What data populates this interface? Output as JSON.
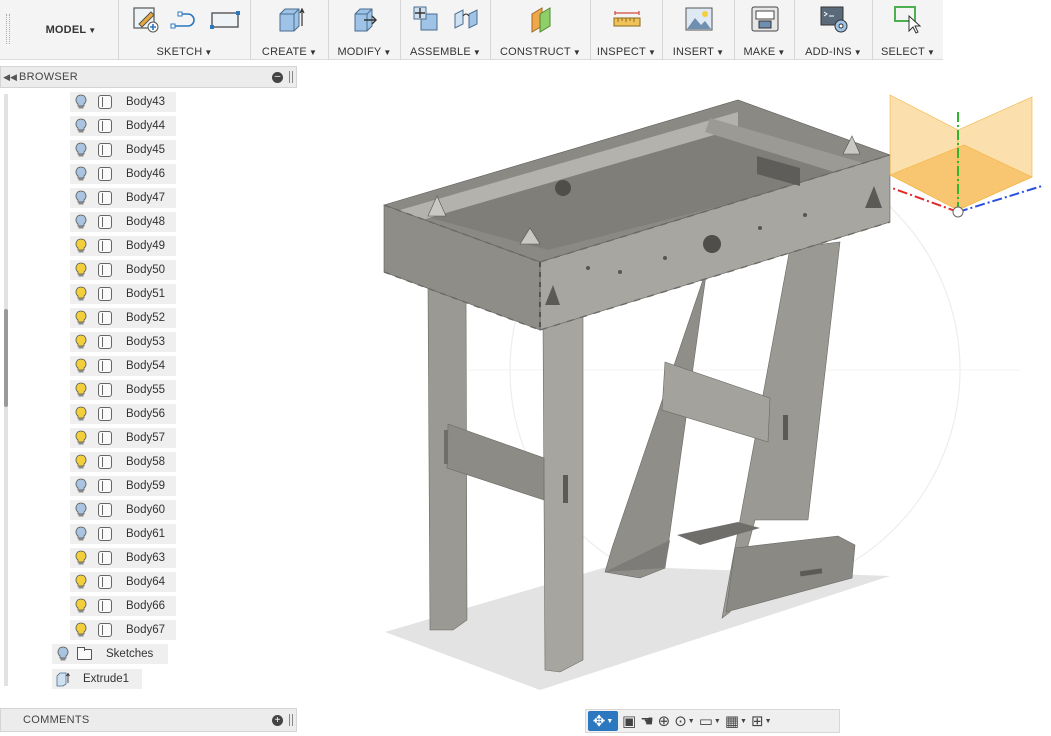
{
  "toolbar": {
    "workspace_label": "MODEL",
    "groups": [
      {
        "label": "SKETCH"
      },
      {
        "label": "CREATE"
      },
      {
        "label": "MODIFY"
      },
      {
        "label": "ASSEMBLE"
      },
      {
        "label": "CONSTRUCT"
      },
      {
        "label": "INSPECT"
      },
      {
        "label": "INSERT"
      },
      {
        "label": "MAKE"
      },
      {
        "label": "ADD-INS"
      },
      {
        "label": "SELECT"
      }
    ]
  },
  "browser": {
    "title": "BROWSER",
    "bodies": [
      {
        "name": "Body43",
        "visible_state": "hidden"
      },
      {
        "name": "Body44",
        "visible_state": "hidden"
      },
      {
        "name": "Body45",
        "visible_state": "hidden"
      },
      {
        "name": "Body46",
        "visible_state": "hidden"
      },
      {
        "name": "Body47",
        "visible_state": "hidden"
      },
      {
        "name": "Body48",
        "visible_state": "hidden"
      },
      {
        "name": "Body49",
        "visible_state": "visible"
      },
      {
        "name": "Body50",
        "visible_state": "visible"
      },
      {
        "name": "Body51",
        "visible_state": "visible"
      },
      {
        "name": "Body52",
        "visible_state": "visible"
      },
      {
        "name": "Body53",
        "visible_state": "visible"
      },
      {
        "name": "Body54",
        "visible_state": "visible"
      },
      {
        "name": "Body55",
        "visible_state": "visible"
      },
      {
        "name": "Body56",
        "visible_state": "visible"
      },
      {
        "name": "Body57",
        "visible_state": "visible"
      },
      {
        "name": "Body58",
        "visible_state": "visible"
      },
      {
        "name": "Body59",
        "visible_state": "hidden"
      },
      {
        "name": "Body60",
        "visible_state": "hidden"
      },
      {
        "name": "Body61",
        "visible_state": "hidden"
      },
      {
        "name": "Body63",
        "visible_state": "visible"
      },
      {
        "name": "Body64",
        "visible_state": "visible"
      },
      {
        "name": "Body66",
        "visible_state": "visible"
      },
      {
        "name": "Body67",
        "visible_state": "visible"
      }
    ],
    "sketches_label": "Sketches",
    "extrude_label": "Extrude1"
  },
  "comments": {
    "title": "COMMENTS"
  },
  "colors": {
    "bulb_on": "#f2cf3b",
    "bulb_off": "#a9c3e0",
    "accent": "#2b77c0",
    "model": "#8f8e89"
  }
}
